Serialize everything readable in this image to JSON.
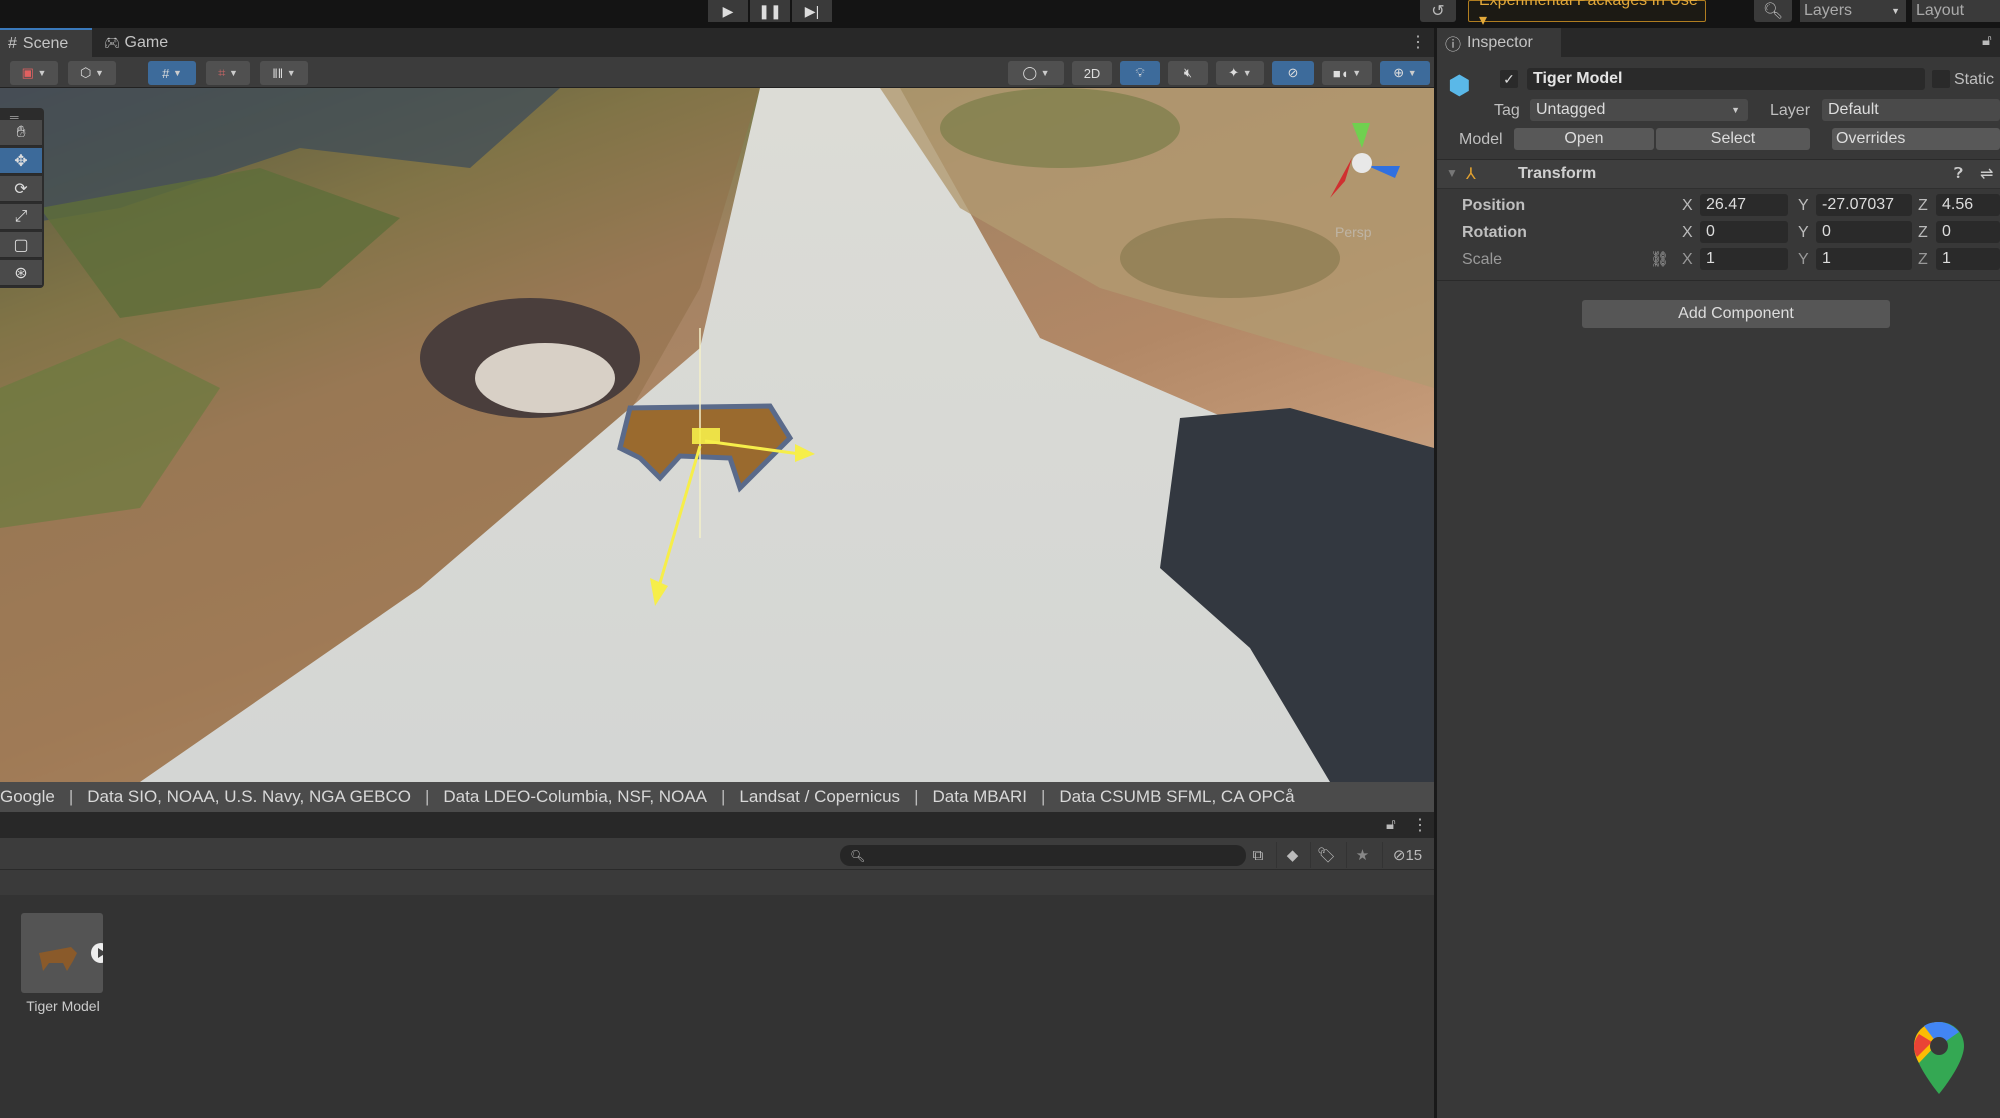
{
  "topbar": {
    "play_icon": "play-icon",
    "pause_icon": "pause-icon",
    "step_icon": "step-icon",
    "history_icon": "history-icon",
    "experimental_label": "Experimental Packages In Use ▾",
    "search_icon": "search-icon",
    "layers_label": "Layers",
    "layout_label": "Layout"
  },
  "scene_tabs": [
    {
      "label": "Scene",
      "icon": "grid-icon",
      "active": true
    },
    {
      "label": "Game",
      "icon": "gamepad-icon",
      "active": false
    }
  ],
  "scene_toolbar": {
    "twod_label": "2D",
    "tools": [
      "hand",
      "move",
      "rotate",
      "scale",
      "rect",
      "transform"
    ]
  },
  "attribution": [
    "Google",
    "Data SIO, NOAA, U.S. Navy, NGA GEBCO",
    "Data LDEO-Columbia, NSF, NOAA",
    "Landsat / Copernicus",
    "Data MBARI",
    "Data CSUMB SFML, CA OPCå"
  ],
  "gizmo": {
    "label": "Persp"
  },
  "project": {
    "search_placeholder": "",
    "hidden_count": "15",
    "assets": [
      {
        "name": "Tiger Model"
      }
    ]
  },
  "inspector": {
    "tab_label": "Inspector",
    "object_name": "Tiger Model",
    "active": true,
    "static_label": "Static",
    "tag_label": "Tag",
    "tag_value": "Untagged",
    "layer_label": "Layer",
    "layer_value": "Default",
    "model_label": "Model",
    "open_label": "Open",
    "select_label": "Select",
    "overrides_label": "Overrides",
    "transform": {
      "title": "Transform",
      "rows": [
        {
          "label": "Position",
          "x": "26.47",
          "y": "-27.07037",
          "z": "4.56"
        },
        {
          "label": "Rotation",
          "x": "0",
          "y": "0",
          "z": "0"
        },
        {
          "label": "Scale",
          "x": "1",
          "y": "1",
          "z": "1"
        }
      ]
    },
    "add_component_label": "Add Component"
  },
  "axis_labels": {
    "x": "X",
    "y": "Y",
    "z": "Z"
  },
  "colors": {
    "accent": "#3d6b9b",
    "experimental": "#e3a93a"
  }
}
